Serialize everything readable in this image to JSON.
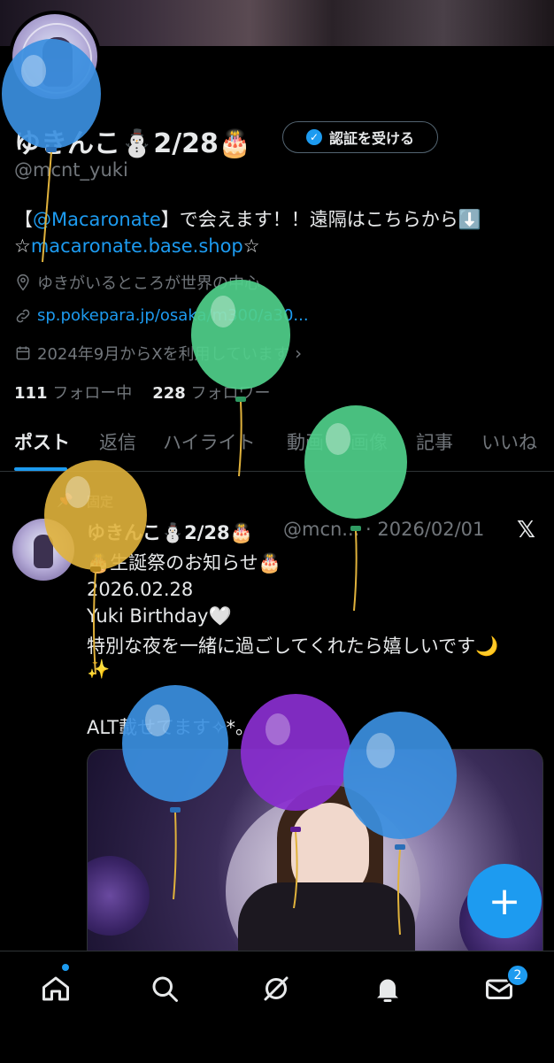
{
  "profile": {
    "name": "ゆきんこ⛄2/28🎂",
    "verify_label": "認証を受ける",
    "handle": "@mcnt_yuki",
    "bio_bracket_open": "【",
    "bio_mention": "@Macaronate",
    "bio_rest": "】で会えます！！遠隔はこちらから⬇️",
    "bio_star": "☆",
    "bio_link": "macaronate.base.shop",
    "bio_star_end": "☆",
    "location": "ゆきがいるところが世界の中心",
    "website": "sp.pokepara.jp/osaka/m300/a30...",
    "joined": "2024年9月からXを利用しています",
    "following_count": "111",
    "following_label": "フォロー中",
    "followers_count": "228",
    "followers_label": "フォロワー"
  },
  "tabs": [
    "ポスト",
    "返信",
    "ハイライト",
    "動画",
    "画像",
    "記事",
    "いいね"
  ],
  "post": {
    "pinned_label": "固定",
    "name": "ゆきんこ⛄2/28🎂",
    "handle_date": "@mcn... · 2026/02/01",
    "lines": [
      "🎂生誕祭のお知らせ🎂",
      "2026.02.28",
      "Yuki Birthday🤍",
      "特別な夜を一緒に過ごしてくれたら嬉しいです🌙",
      "✨",
      "",
      "ALT載せてます✧*。"
    ]
  },
  "fab_label": "+",
  "bottom_nav": {
    "notification_count": "2",
    "icons": [
      "home-icon",
      "search-icon",
      "grok-icon",
      "bell-icon",
      "mail-icon"
    ]
  },
  "colors": {
    "accent": "#1d9bf0",
    "background": "#000000",
    "text": "#e7e9ea",
    "muted": "#71767b",
    "balloon_blue": "#3b8fe0",
    "balloon_green": "#4fcf8a",
    "balloon_yellow": "#e0b23c",
    "balloon_purple": "#8a2fd0"
  }
}
